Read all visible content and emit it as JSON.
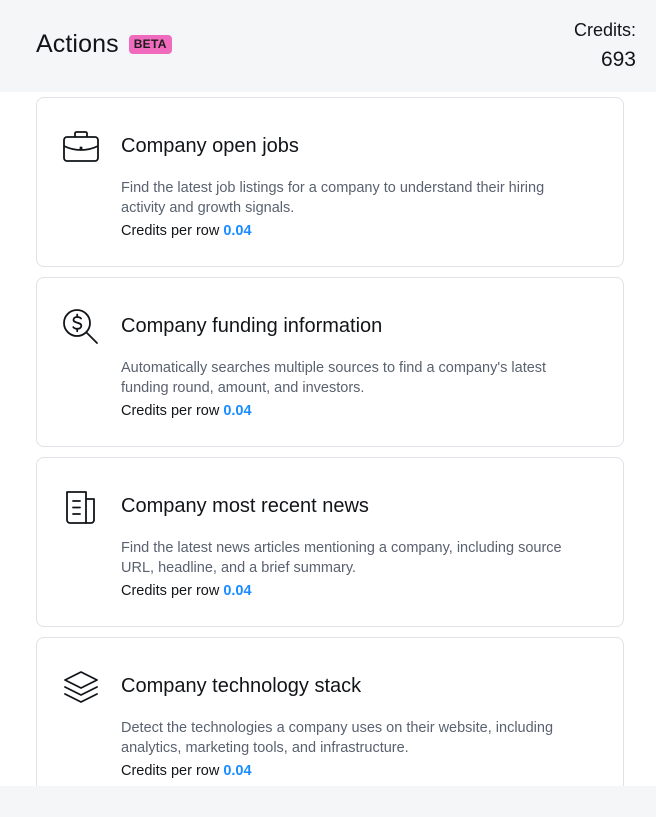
{
  "header": {
    "title": "Actions",
    "badge": "BETA",
    "credits_label": "Credits:",
    "credits_value": "693"
  },
  "cards": [
    {
      "icon": "briefcase-icon",
      "title": "Company open jobs",
      "description": "Find the latest job listings for a company to understand their hiring activity and growth signals.",
      "credits_label": "Credits per row",
      "credits_value": "0.04"
    },
    {
      "icon": "dollar-search-icon",
      "title": "Company funding information",
      "description": "Automatically searches multiple sources to find a company's latest funding round, amount, and investors.",
      "credits_label": "Credits per row",
      "credits_value": "0.04"
    },
    {
      "icon": "newspaper-icon",
      "title": "Company most recent news",
      "description": "Find the latest news articles mentioning a company, including source URL, headline, and a brief summary.",
      "credits_label": "Credits per row",
      "credits_value": "0.04"
    },
    {
      "icon": "layers-icon",
      "title": "Company technology stack",
      "description": "Detect the technologies a company uses on their website, including analytics, marketing tools, and infrastructure.",
      "credits_label": "Credits per row",
      "credits_value": "0.04"
    }
  ],
  "colors": {
    "badge": "#f06bbd",
    "credit_value": "#1a8cff",
    "header_bg": "#f5f6f8"
  }
}
